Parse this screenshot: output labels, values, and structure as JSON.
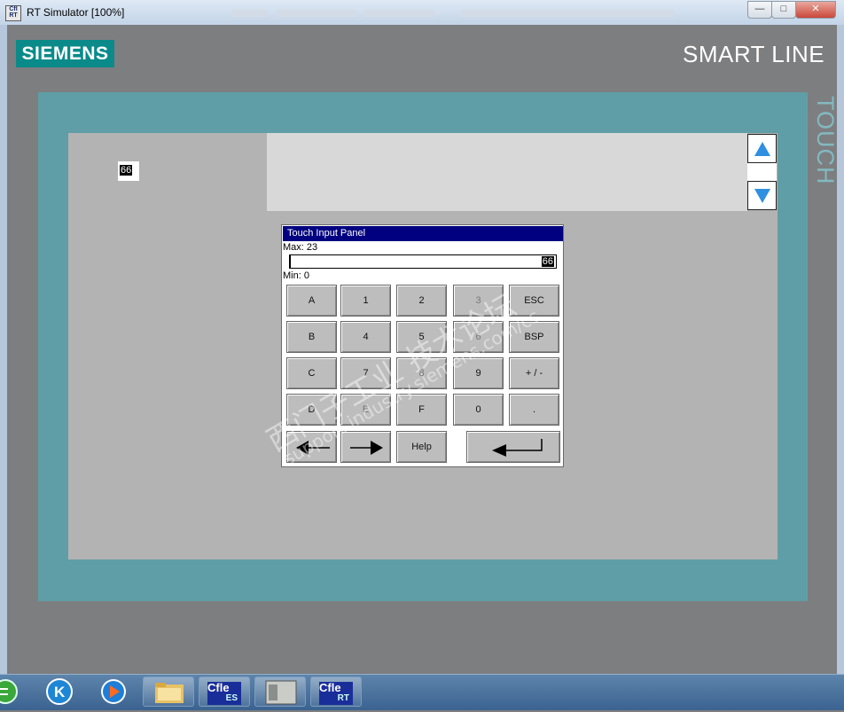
{
  "window": {
    "title": "RT Simulator [100%]",
    "app_icon_text": "CfI RT",
    "minimize_glyph": "—",
    "maximize_glyph": "□",
    "close_glyph": "✕"
  },
  "hmi": {
    "brand": "SIEMENS",
    "model": "SMART LINE",
    "side_label": "TOUCH",
    "io_field_value": "66",
    "brand_color": "#0b8a8a",
    "frame_color": "#5f9ea6"
  },
  "input_panel": {
    "title": "Touch Input Panel",
    "max_label": "Max: 23",
    "min_label": "Min:  0",
    "current_value": "66",
    "keys": {
      "A": "A",
      "B": "B",
      "C": "C",
      "D": "D",
      "one": "1",
      "two": "2",
      "three": "3",
      "four": "4",
      "five": "5",
      "six": "6",
      "seven": "7",
      "eight": "8",
      "nine": "9",
      "zero": "0",
      "E": "E",
      "F": "F",
      "esc": "ESC",
      "bsp": "BSP",
      "plus_minus": "+ / -",
      "dot": ".",
      "help": "Help"
    }
  },
  "watermark": {
    "line1": "西门子工业  技术论坛",
    "line2": "support.industry.siemens.com/cs"
  },
  "taskbar": {
    "apps": [
      {
        "name": "sync",
        "icon": "green-circle-icon"
      },
      {
        "name": "k-app",
        "label": "K"
      },
      {
        "name": "media-player",
        "icon": "play-icon"
      },
      {
        "name": "explorer",
        "icon": "folder-icon"
      },
      {
        "name": "cflex-es",
        "label": "Cfle",
        "sub": "ES"
      },
      {
        "name": "window-preview",
        "icon": "window-icon"
      },
      {
        "name": "cflex-rt",
        "label": "Cfle",
        "sub": "RT"
      }
    ]
  }
}
